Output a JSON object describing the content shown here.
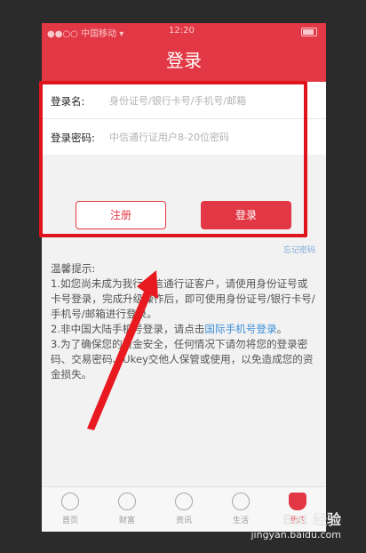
{
  "status_bar": {
    "carrier": "●●○○ 中国移动 ▾",
    "time": "12:20"
  },
  "navbar": {
    "title": "登录"
  },
  "form": {
    "username_label": "登录名:",
    "username_placeholder": "身份证号/银行卡号/手机号/邮箱",
    "password_label": "登录密码:",
    "password_placeholder": "中信通行证用户8-20位密码"
  },
  "buttons": {
    "register": "注册",
    "login": "登录"
  },
  "forgot_password": "忘记密码",
  "tips": {
    "title": "温馨提示:",
    "item1": "1.如您尚未成为我行中信通行证客户，请使用身份证号或卡号登录，完成升级操作后，即可使用身份证号/银行卡号/手机号/邮箱进行登录。",
    "item2_prefix": "2.非中国大陆手机号登录，请点击",
    "item2_link": "国际手机号登录",
    "item2_suffix": "。",
    "item3": "3.为了确保您的资金安全，任何情况下请勿将您的登录密码、交易密码、Ukey交他人保管或使用，以免造成您的资金损失。"
  },
  "tabbar": {
    "tabs": [
      {
        "label": "首页"
      },
      {
        "label": "财富"
      },
      {
        "label": "资讯"
      },
      {
        "label": "生活"
      },
      {
        "label": "我的"
      }
    ]
  },
  "watermark": {
    "brand": "Bai 经验",
    "url": "jingyan.baidu.com"
  },
  "colors": {
    "brand": "#e23845",
    "highlight": "#e0141d",
    "link": "#3f8fd8"
  }
}
